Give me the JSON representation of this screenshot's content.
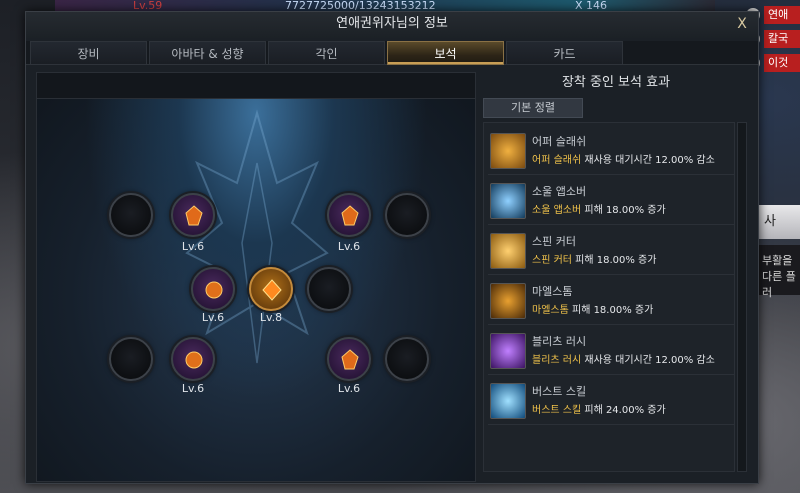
{
  "hud": {
    "level": "Lv.59",
    "exp": "7727725000/13243153212",
    "multiplier": "X 146"
  },
  "side": {
    "tags": [
      "연애",
      "칼국",
      "이것"
    ],
    "button": "사",
    "panel_line1": "부활을",
    "panel_line2": "다른 플러"
  },
  "dialog": {
    "title": "연애권위자님의 정보",
    "close": "X",
    "tabs": [
      "장비",
      "아바타 & 성향",
      "각인",
      "보석",
      "카드"
    ],
    "active_tab": "보석"
  },
  "board": {
    "sockets": [
      {
        "level": "",
        "color": "empty"
      },
      {
        "level": "Lv.6",
        "color": "purple"
      },
      {
        "level": "Lv.6",
        "color": "purple"
      },
      {
        "level": "",
        "color": "empty"
      },
      {
        "level": "Lv.6",
        "color": "purple"
      },
      {
        "level": "Lv.8",
        "color": "orange"
      },
      {
        "level": "",
        "color": "empty"
      },
      {
        "level": "",
        "color": "empty"
      },
      {
        "level": "Lv.6",
        "color": "purple"
      },
      {
        "level": "Lv.6",
        "color": "purple"
      },
      {
        "level": "",
        "color": "empty"
      }
    ]
  },
  "effects": {
    "title": "장착 중인 보석 효과",
    "sort_label": "기본 정렬",
    "items": [
      {
        "name": "어퍼 슬래쉬",
        "skill": "어퍼 슬래쉬",
        "effect": " 재사용 대기시간 12.00% 감소",
        "icon": "upper-slash-icon",
        "color": "#c07a20"
      },
      {
        "name": "소울 앱소버",
        "skill": "소울 앱소버",
        "effect": " 피해 18.00% 증가",
        "icon": "soul-absorber-icon",
        "color": "#2a7ab8"
      },
      {
        "name": "스핀 커터",
        "skill": "스핀 커터",
        "effect": " 피해 18.00% 증가",
        "icon": "spin-cutter-icon",
        "color": "#c8952a"
      },
      {
        "name": "마엘스톰",
        "skill": "마엘스톰",
        "effect": " 피해 18.00% 증가",
        "icon": "maelstrom-icon",
        "color": "#a06a1a"
      },
      {
        "name": "블리츠 러시",
        "skill": "블리츠 러시",
        "effect": " 재사용 대기시간 12.00% 감소",
        "icon": "blitz-rush-icon",
        "color": "#7a3ad0"
      },
      {
        "name": "버스트 스킬",
        "skill": "버스트 스킬",
        "effect": " 피해 24.00% 증가",
        "icon": "burst-skill-icon",
        "color": "#3a9ad8"
      }
    ]
  }
}
